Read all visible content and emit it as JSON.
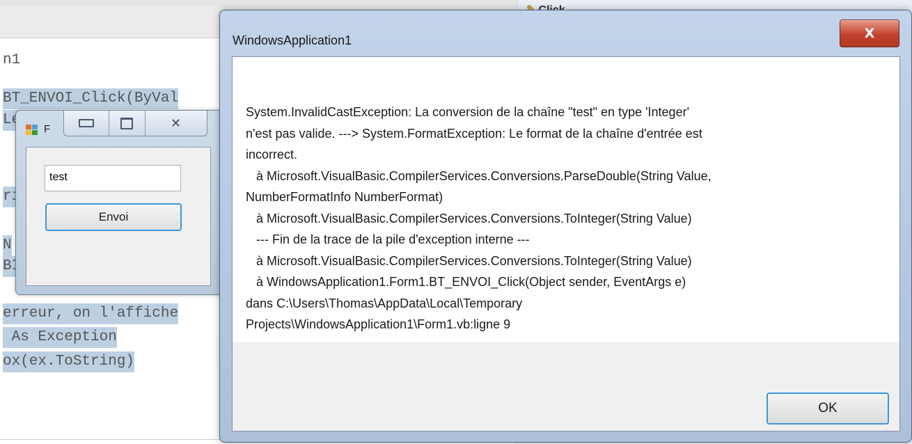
{
  "ide": {
    "right_tab_label": "Click",
    "code_lines": [
      "n1",
      "BT_ENVOI_Click(ByVal",
      "Le",
      "ri",
      "N",
      "BI",
      "erreur, on l'affiche",
      " As Exception",
      "ox(ex.ToString)"
    ]
  },
  "form1": {
    "title": "F",
    "textbox_value": "test",
    "button_label": "Envoi"
  },
  "messagebox": {
    "title": "WindowsApplication1",
    "close_glyph": "X",
    "message": "System.InvalidCastException: La conversion de la chaîne \"test\" en type 'Integer'\nn'est pas valide. ---> System.FormatException: Le format de la chaîne d'entrée est\nincorrect.\n   à Microsoft.VisualBasic.CompilerServices.Conversions.ParseDouble(String Value,\nNumberFormatInfo NumberFormat)\n   à Microsoft.VisualBasic.CompilerServices.Conversions.ToInteger(String Value)\n   --- Fin de la trace de la pile d'exception interne ---\n   à Microsoft.VisualBasic.CompilerServices.Conversions.ToInteger(String Value)\n   à WindowsApplication1.Form1.BT_ENVOI_Click(Object sender, EventArgs e)\ndans C:\\Users\\Thomas\\AppData\\Local\\Temporary\nProjects\\WindowsApplication1\\Form1.vb:ligne 9",
    "ok_label": "OK"
  }
}
